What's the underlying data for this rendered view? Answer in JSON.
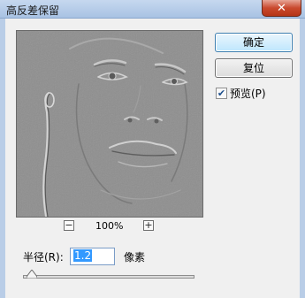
{
  "dialog": {
    "title": "高反差保留",
    "close_glyph": "✕"
  },
  "preview": {
    "zoom_level": "100%",
    "zoom_out_glyph": "−",
    "zoom_in_glyph": "+"
  },
  "buttons": {
    "ok": "确定",
    "reset": "复位"
  },
  "preview_checkbox": {
    "label": "预览(P)",
    "checked": true
  },
  "radius": {
    "label": "半径(R):",
    "value": "1.2",
    "unit": "像素",
    "slider_fraction": 0.05
  }
}
